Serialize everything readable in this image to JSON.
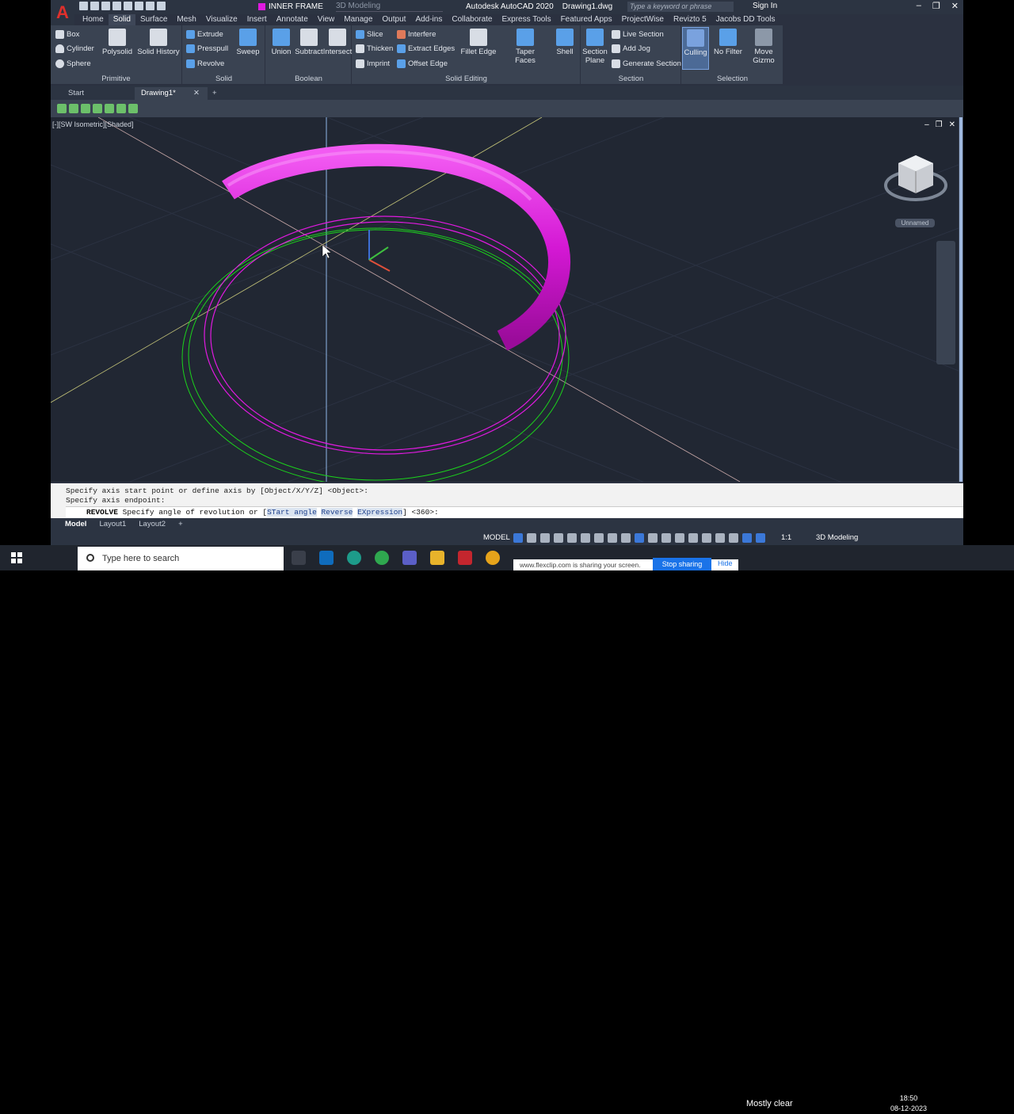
{
  "window": {
    "app_title": "Autodesk AutoCAD 2020",
    "doc_title": "Drawing1.dwg",
    "search_placeholder": "Type a keyword or phrase",
    "sign_in": "Sign In",
    "layer": "INNER FRAME",
    "workspace": "3D Modeling"
  },
  "ribbon_tabs": [
    "Home",
    "Solid",
    "Surface",
    "Mesh",
    "Visualize",
    "Insert",
    "Annotate",
    "View",
    "Manage",
    "Output",
    "Add-ins",
    "Collaborate",
    "Express Tools",
    "Featured Apps",
    "ProjectWise",
    "Revizto 5",
    "Jacobs DD Tools"
  ],
  "active_tab": "Solid",
  "primitive": {
    "title": "Primitive",
    "box": "Box",
    "cylinder": "Cylinder",
    "sphere": "Sphere",
    "polysolid": "Polysolid",
    "solid_history": "Solid History"
  },
  "solid": {
    "title": "Solid",
    "extrude": "Extrude",
    "presspull": "Presspull",
    "revolve": "Revolve",
    "sweep": "Sweep"
  },
  "boolean": {
    "title": "Boolean",
    "union": "Union",
    "subtract": "Subtract",
    "intersect": "Intersect"
  },
  "solid_editing": {
    "title": "Solid Editing",
    "slice": "Slice",
    "thicken": "Thicken",
    "imprint": "Imprint",
    "interfere": "Interfere",
    "extract_edges": "Extract Edges",
    "offset_edge": "Offset Edge",
    "fillet_edge": "Fillet Edge",
    "taper_faces": "Taper Faces",
    "shell": "Shell"
  },
  "section": {
    "title": "Section",
    "section_plane": "Section Plane",
    "live_section": "Live Section",
    "add_jog": "Add Jog",
    "generate_section": "Generate Section"
  },
  "selection": {
    "title": "Selection",
    "culling": "Culling",
    "no_filter": "No Filter",
    "move_gizmo": "Move Gizmo"
  },
  "doc_tabs": {
    "start": "Start",
    "drawing": "Drawing1*"
  },
  "viewport": {
    "label": "[-][SW Isometric][Shaded]",
    "view_name": "Unnamed"
  },
  "command": {
    "history": [
      "Specify axis start point or define axis by [Object/X/Y/Z] <Object>:",
      "Specify axis endpoint:"
    ],
    "cmd_name": "REVOLVE",
    "prompt_pre": "Specify angle of revolution or [",
    "kw1": "STart angle",
    "kw2": "Reverse",
    "kw3": "EXpression",
    "prompt_post": "] <360>:"
  },
  "layout_tabs": [
    "Model",
    "Layout1",
    "Layout2"
  ],
  "status": {
    "model": "MODEL",
    "scale": "1:1",
    "workspace": "3D Modeling"
  },
  "taskbar": {
    "search": "Type here to search",
    "share_text": "www.flexclip.com is sharing your screen.",
    "stop_sharing": "Stop sharing",
    "hide": "Hide",
    "weather": "Mostly clear",
    "time": "18:50",
    "date": "08-12-2023"
  },
  "colors": {
    "ring_magenta": "#e01ae0",
    "ring_green": "#1bd31b",
    "accent_blue": "#3b78d8",
    "logo_red": "#e0302c"
  }
}
